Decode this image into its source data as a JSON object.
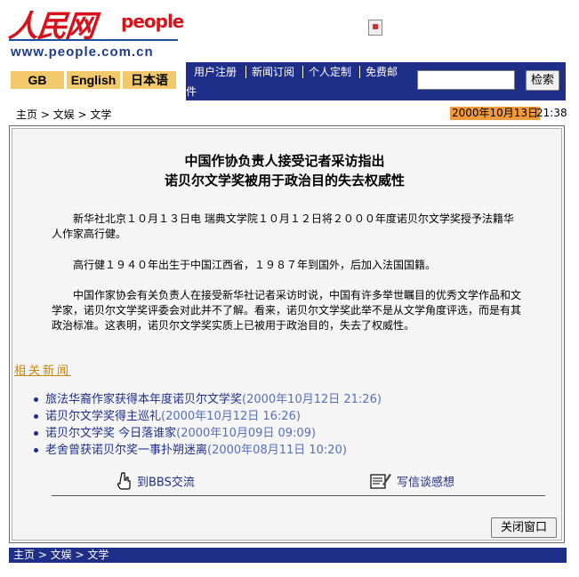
{
  "header": {
    "logo_cn": "人民网",
    "logo_en": "people",
    "logo_url": "www.people.com.cn"
  },
  "lang": {
    "gb": "GB",
    "english": "English",
    "japanese": "日本语"
  },
  "menu": {
    "register": "用户注册",
    "subscribe": "新闻订阅",
    "personal": "个人定制",
    "free_mail_1": "免费邮",
    "free_mail_2": "件"
  },
  "search": {
    "button": "检索",
    "value": ""
  },
  "breadcrumb": {
    "text": "主页 > 文娱 > 文学",
    "date": "2000年10月13日",
    "time": "21:38"
  },
  "article": {
    "title_1": "中国作协负责人接受记者采访指出",
    "title_2": "诺贝尔文学奖被用于政治目的失去权威性",
    "paragraphs": [
      "新华社北京１０月１３日电 瑞典文学院１０月１２日将２０００年度诺贝尔文学奖授予法籍华人作家高行健。",
      "高行健１９４０年出生于中国江西省，１９８７年到国外，后加入法国国籍。",
      "中国作家协会有关负责人在接受新华社记者采访时说，中国有许多举世瞩目的优秀文学作品和文学家，诺贝尔文学奖评委会对此并不了解。看来，诺贝尔文学奖此举不是从文学角度评选，而是有其政治标准。这表明，诺贝尔文学奖实质上已被用于政治目的，失去了权威性。"
    ]
  },
  "related": {
    "title": "相关新闻",
    "items": [
      {
        "title": "旅法华裔作家获得本年度诺贝尔文学奖",
        "date": "(2000年10月12日 21:26)"
      },
      {
        "title": "诺贝尔文学奖得主巡礼",
        "date": "(2000年10月12日 16:26)"
      },
      {
        "title": "诺贝尔文学奖 今日落谁家",
        "date": "(2000年10月09日 09:09)"
      },
      {
        "title": "老舍曾获诺贝尔奖一事扑朔迷离",
        "date": "(2000年08月11日 10:20)"
      }
    ]
  },
  "actions": {
    "bbs": "到BBS交流",
    "letter": "写信谈感想",
    "close": "关闭窗口"
  },
  "footer": {
    "breadcrumb": "主页 > 文娱 > 文学"
  },
  "colors": {
    "navy": "#1f2e88",
    "gold": "#f2c96a",
    "red": "#d8121a",
    "orange": "#f39a3b"
  }
}
